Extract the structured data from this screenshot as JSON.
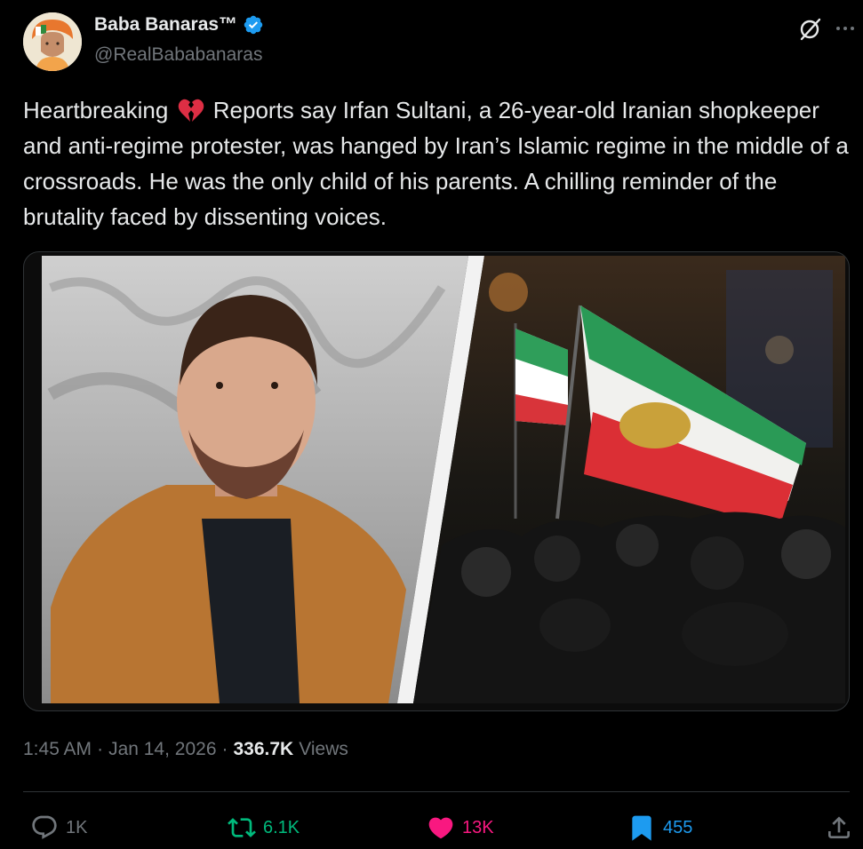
{
  "author": {
    "display_name": "Baba Banaras™",
    "handle": "@RealBababanaras",
    "verified": true,
    "verified_color": "#1d9bf0"
  },
  "tweet": {
    "text_before_emoji": "Heartbreaking",
    "emoji": "broken-heart-emoji",
    "text_after_emoji": " Reports say Irfan Sultani, a 26-year-old Iranian shopkeeper and anti-regime protester, was hanged by Iran’s Islamic regime in the middle of a crossroads. He was the only child of his parents. A chilling reminder of the brutality faced by dissenting voices."
  },
  "meta": {
    "time": "1:45 AM",
    "sep1": "·",
    "date": "Jan 14, 2026",
    "sep2": "·",
    "views_count": "336.7K",
    "views_label": "Views"
  },
  "actions": {
    "reply_count": "1K",
    "retweet_count": "6.1K",
    "like_count": "13K",
    "bookmark_count": "455"
  },
  "colors": {
    "background": "#000000",
    "text_primary": "#e7e9ea",
    "text_secondary": "#71767b",
    "retweet_green": "#00ba7c",
    "like_pink": "#f91880",
    "bookmark_blue": "#1d9bf0",
    "divider": "#2f3336"
  },
  "icons": [
    "grok-icon",
    "more-icon",
    "reply-icon",
    "retweet-icon",
    "like-icon",
    "bookmark-icon",
    "share-icon",
    "verified-badge-icon"
  ]
}
